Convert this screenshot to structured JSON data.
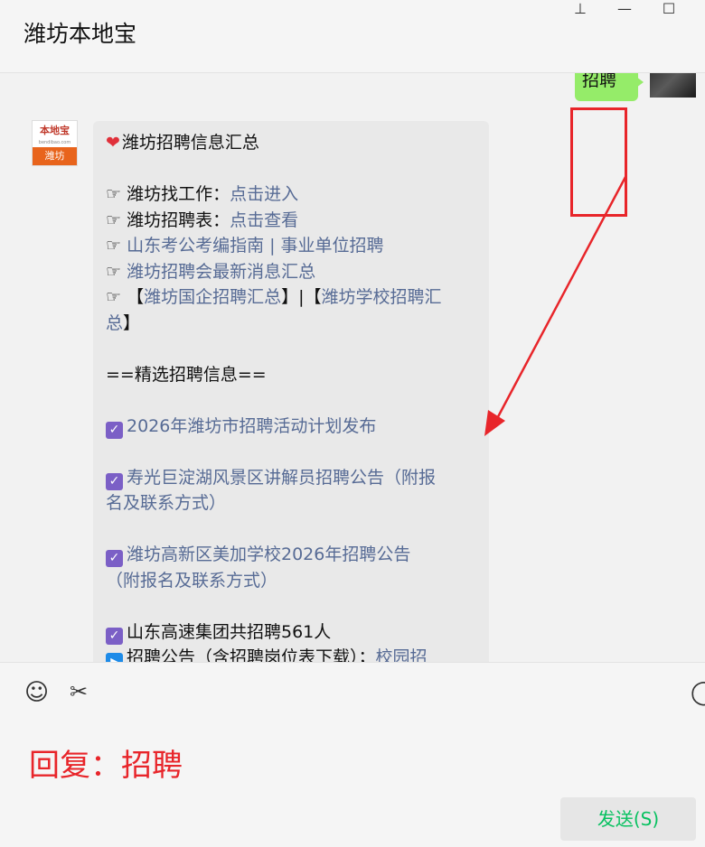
{
  "window": {
    "title": "潍坊本地宝"
  },
  "controls": {
    "pin": "⊥",
    "minimize": "—",
    "maximize": "☐"
  },
  "sent_message": {
    "text": "招聘"
  },
  "avatar_left": {
    "brand": "本地宝",
    "domain": "bendibao.com",
    "city": "潍坊"
  },
  "message": {
    "heading": "潍坊招聘信息汇总",
    "links": [
      {
        "prefix": "☞ 潍坊找工作：",
        "link": "点击进入"
      },
      {
        "prefix": "☞ 潍坊招聘表：",
        "link": "点击查看"
      },
      {
        "prefix": "☞ ",
        "link": "山东考公考编指南 | 事业单位招聘"
      },
      {
        "prefix": "☞ ",
        "link": "潍坊招聘会最新消息汇总"
      }
    ],
    "soe_line1_prefix": "☞ 【",
    "soe_line1_link_a": "潍坊国企招聘汇总",
    "soe_line1_mid": "】|【",
    "soe_line1_link_b": "潍坊学校招聘汇",
    "soe_line2_link": "总",
    "soe_line2_suffix": "】",
    "section_title": "==精选招聘信息==",
    "item1": "2026年潍坊市招聘活动计划发布",
    "item2_l1": "寿光巨淀湖风景区讲解员招聘公告（附报",
    "item2_l2": "名及联系方式）",
    "item3_l1": "潍坊高新区美加学校2026年招聘公告",
    "item3_l2": "（附报名及联系方式）",
    "item4": "山东高速集团共招聘561人",
    "item5_prefix": "招聘公告（含招聘岗位表下载）；",
    "item5_link": "校园招"
  },
  "toolbar": {
    "emoji": "☺",
    "scissors": "✂"
  },
  "annotation": {
    "reply_hint": "回复：招聘"
  },
  "send_button": {
    "label": "发送(S)"
  },
  "colors": {
    "accent_red": "#e8252a",
    "link": "#576b95",
    "wechat_green": "#95ec69",
    "send_text": "#07c160"
  }
}
